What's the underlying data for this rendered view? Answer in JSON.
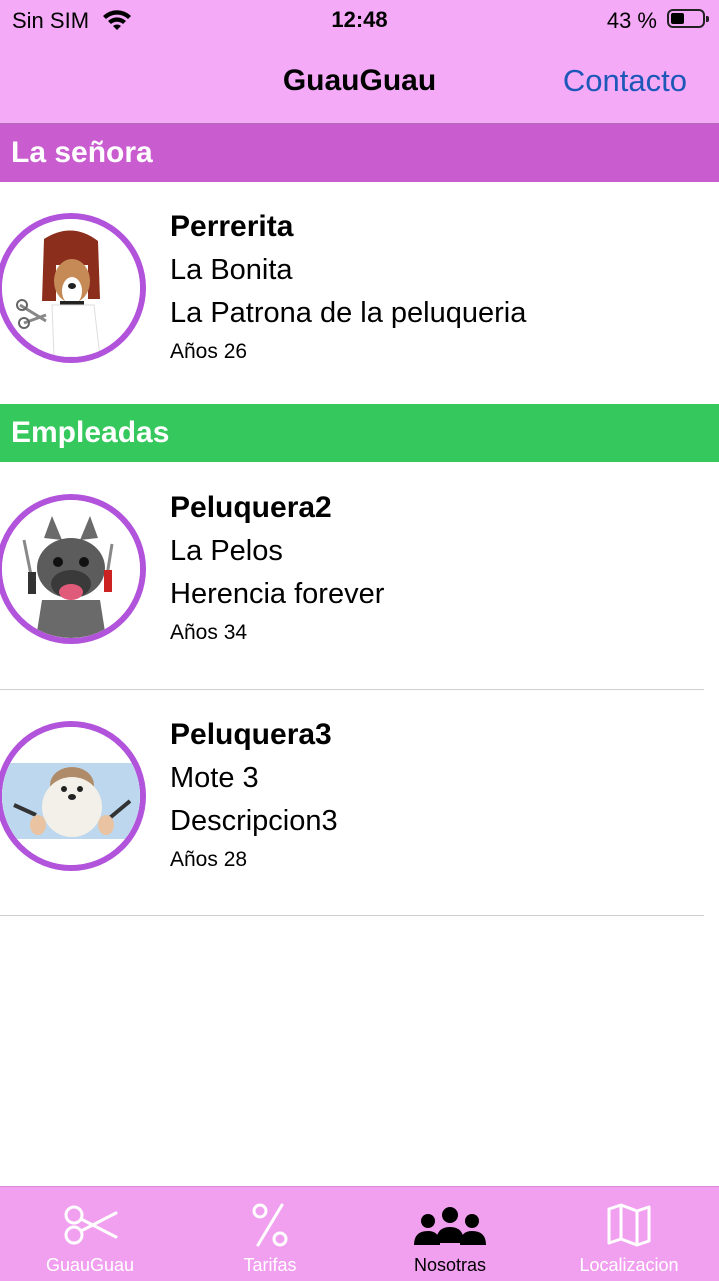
{
  "status_bar": {
    "carrier": "Sin SIM",
    "time": "12:48",
    "battery_percent": "43 %",
    "battery_level": 0.43
  },
  "nav": {
    "title": "GuauGuau",
    "action_label": "Contacto"
  },
  "sections": [
    {
      "title": "La señora",
      "color": "#c95dd0",
      "items": [
        {
          "name": "Perrerita",
          "nickname": "La Bonita",
          "description": "La Patrona de la peluqueria",
          "age": "Años 26"
        }
      ]
    },
    {
      "title": "Empleadas",
      "color": "#35c85c",
      "items": [
        {
          "name": "Peluquera2",
          "nickname": "La Pelos",
          "description": "Herencia forever",
          "age": "Años 34"
        },
        {
          "name": "Peluquera3",
          "nickname": "Mote 3",
          "description": "Descripcion3",
          "age": "Años 28"
        }
      ]
    }
  ],
  "tabs": [
    {
      "label": "GuauGuau",
      "icon": "scissors-icon"
    },
    {
      "label": "Tarifas",
      "icon": "percent-icon"
    },
    {
      "label": "Nosotras",
      "icon": "people-icon",
      "active": true
    },
    {
      "label": "Localizacion",
      "icon": "map-icon"
    }
  ],
  "colors": {
    "bar_background": "#f5aaf8",
    "tab_background": "#f1a0f0",
    "accent_link": "#1d57b8",
    "avatar_ring": "#b153db"
  }
}
